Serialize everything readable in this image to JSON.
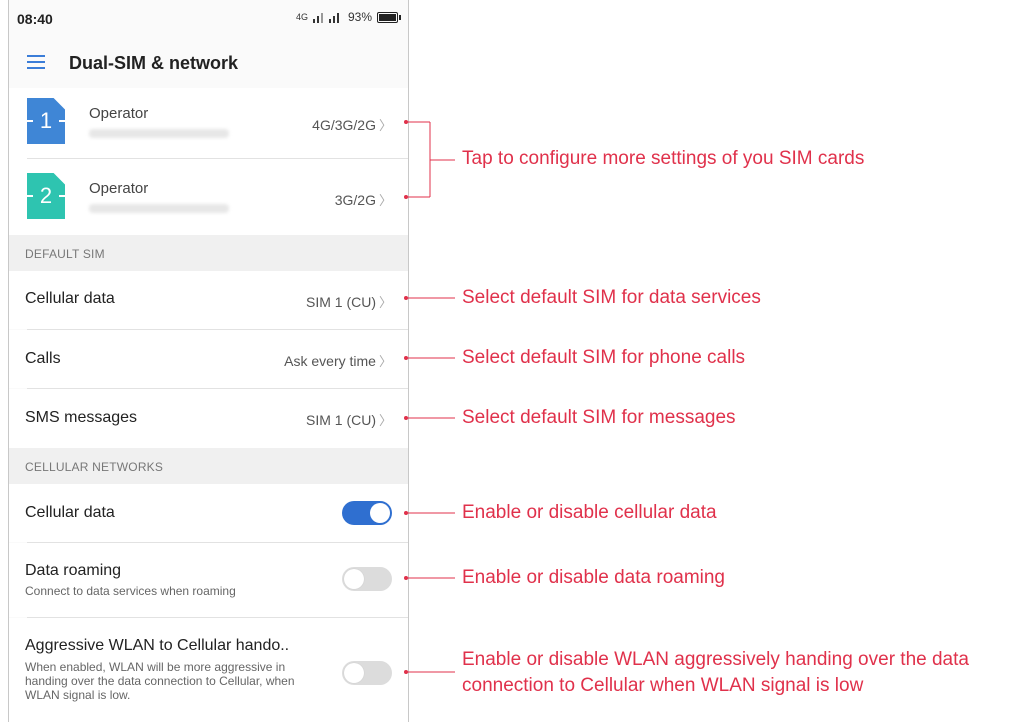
{
  "status_bar": {
    "time": "08:40",
    "network": "4G",
    "battery": "93%"
  },
  "app_bar": {
    "title": "Dual-SIM & network"
  },
  "sims": [
    {
      "number": "1",
      "operator": "Operator",
      "mode": "4G/3G/2G",
      "color": "#3f86d6"
    },
    {
      "number": "2",
      "operator": "Operator",
      "mode": "3G/2G",
      "color": "#2ec4b0"
    }
  ],
  "default_sim": {
    "header": "DEFAULT SIM",
    "rows": [
      {
        "label": "Cellular data",
        "value": "SIM 1 (CU)"
      },
      {
        "label": "Calls",
        "value": "Ask every time"
      },
      {
        "label": "SMS messages",
        "value": "SIM 1 (CU)"
      }
    ]
  },
  "cellular_networks": {
    "header": "CELLULAR NETWORKS",
    "rows": [
      {
        "label": "Cellular data",
        "subtitle": "",
        "enabled": true
      },
      {
        "label": "Data roaming",
        "subtitle": "Connect to data services when roaming",
        "enabled": false
      },
      {
        "label": "Aggressive WLAN to Cellular hando..",
        "subtitle": "When enabled, WLAN will be more aggressive in handing over the data connection to Cellular, when WLAN signal is low.",
        "enabled": false
      }
    ]
  },
  "callouts": {
    "sim_cards": "Tap to configure more settings of you SIM cards",
    "data_services": "Select default SIM for data services",
    "phone_calls": "Select default SIM for phone calls",
    "messages": "Select default SIM for messages",
    "cellular_data": "Enable or disable cellular data",
    "data_roaming": "Enable or disable data roaming",
    "wlan_line1": "Enable or disable WLAN aggressively handing over the data",
    "wlan_line2": "connection to Cellular when WLAN signal is low"
  },
  "colors": {
    "accent": "#2f6fd0",
    "callout": "#e0314b"
  }
}
